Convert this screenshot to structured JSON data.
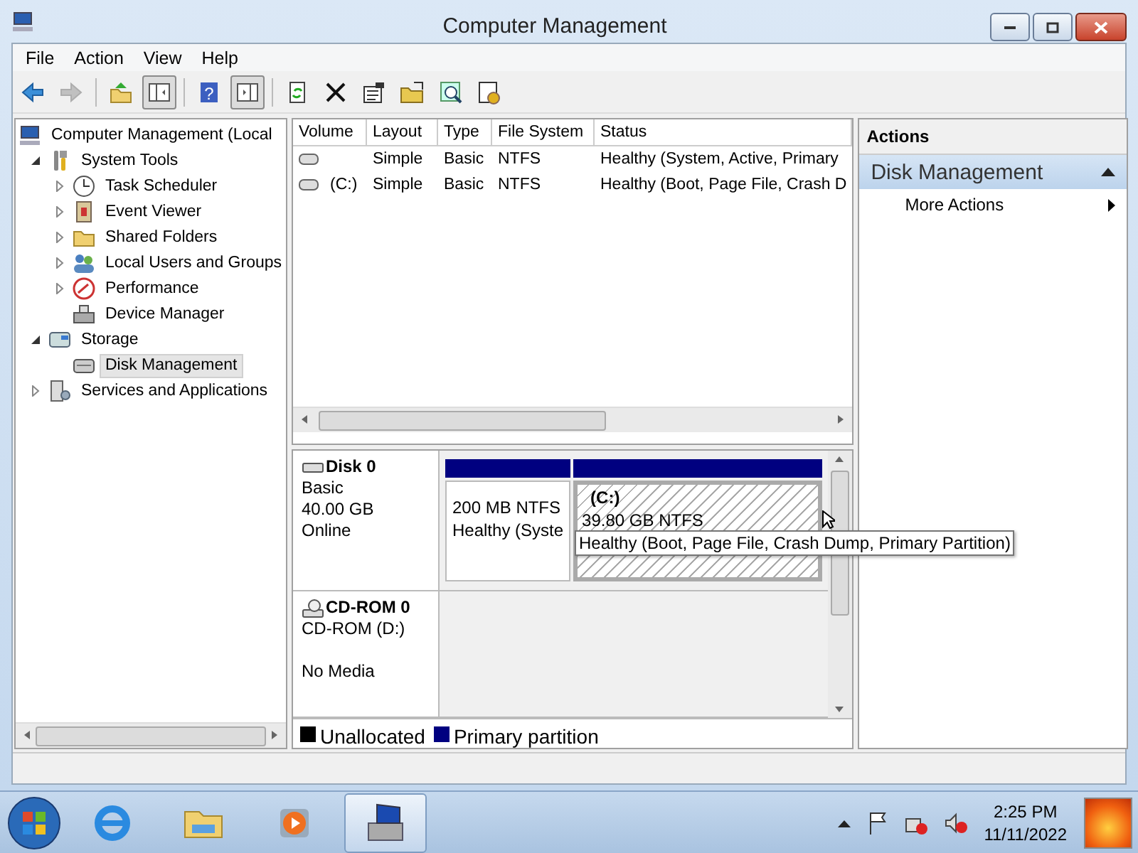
{
  "window": {
    "title": "Computer Management"
  },
  "menu": [
    {
      "label": "File"
    },
    {
      "label": "Action"
    },
    {
      "label": "View"
    },
    {
      "label": "Help"
    }
  ],
  "toolbar": [
    {
      "kind": "back",
      "disabled": false
    },
    {
      "kind": "forward",
      "disabled": true
    },
    {
      "kind": "separator"
    },
    {
      "kind": "up"
    },
    {
      "kind": "console-tree",
      "pressed": true
    },
    {
      "kind": "separator"
    },
    {
      "kind": "help",
      "glyph": "?"
    },
    {
      "kind": "action-pane",
      "pressed": true
    },
    {
      "kind": "separator"
    },
    {
      "kind": "refresh"
    },
    {
      "kind": "delete"
    },
    {
      "kind": "properties"
    },
    {
      "kind": "open"
    },
    {
      "kind": "find"
    },
    {
      "kind": "settings"
    }
  ],
  "tree": {
    "items": [
      {
        "label": "Computer Management (Local",
        "kind": "computer",
        "selected": false,
        "children": [
          {
            "label": "System Tools",
            "kind": "tools",
            "expanded": true,
            "selected": false,
            "children": [
              {
                "label": "Task Scheduler",
                "kind": "clock",
                "expanded": false,
                "selected": false
              },
              {
                "label": "Event Viewer",
                "kind": "log",
                "expanded": false,
                "selected": false
              },
              {
                "label": "Shared Folders",
                "kind": "folder",
                "expanded": false,
                "selected": false
              },
              {
                "label": "Local Users and Groups",
                "kind": "users",
                "expanded": false,
                "selected": false
              },
              {
                "label": "Performance",
                "kind": "gauge",
                "expanded": false,
                "selected": false
              },
              {
                "label": "Device Manager",
                "kind": "device",
                "selected": false
              }
            ]
          },
          {
            "label": "Storage",
            "kind": "storage",
            "expanded": true,
            "selected": false,
            "children": [
              {
                "label": "Disk Management",
                "kind": "disk",
                "selected": true
              }
            ]
          },
          {
            "label": "Services and Applications",
            "kind": "services",
            "expanded": false,
            "selected": false
          }
        ]
      }
    ]
  },
  "volumes": {
    "columns": [
      {
        "label": "Volume"
      },
      {
        "label": "Layout"
      },
      {
        "label": "Type"
      },
      {
        "label": "File System"
      },
      {
        "label": "Status"
      }
    ],
    "rows": [
      {
        "layout": "Simple",
        "type": "Basic",
        "file_system": "NTFS",
        "status": "Healthy (System, Active, Primary"
      },
      {
        "volume": "(C:)",
        "layout": "Simple",
        "type": "Basic",
        "file_system": "NTFS",
        "status": "Healthy (Boot, Page File, Crash D"
      }
    ]
  },
  "disks": [
    {
      "kind": "disk",
      "name": "Disk 0",
      "type": "Basic",
      "size": "40.00 GB",
      "state": "Online",
      "partitions": [
        {
          "size": "200 MB NTFS",
          "status": "Healthy (Syste",
          "selected": false
        },
        {
          "label": "(C:)",
          "size": "39.80 GB NTFS",
          "selected": true
        }
      ]
    },
    {
      "kind": "cdrom",
      "name": "CD-ROM 0",
      "type": "CD-ROM (D:)",
      "state": "No Media"
    }
  ],
  "legend": [
    {
      "label": "Unallocated",
      "color": "#000000"
    },
    {
      "label": "Primary partition",
      "color": "#000080"
    }
  ],
  "tooltip": "Healthy (Boot, Page File, Crash Dump, Primary Partition)",
  "actions": {
    "header": "Actions",
    "sections": [
      {
        "title": "Disk Management",
        "expanded": true,
        "items": [
          {
            "label": "More Actions"
          }
        ]
      }
    ]
  },
  "taskbar": {
    "apps": [
      {
        "kind": "browser",
        "selected": false
      },
      {
        "kind": "explorer",
        "selected": false
      },
      {
        "kind": "media",
        "selected": false
      },
      {
        "kind": "computer-management",
        "selected": true
      }
    ],
    "time": "2:25 PM",
    "date": "11/11/2022"
  }
}
